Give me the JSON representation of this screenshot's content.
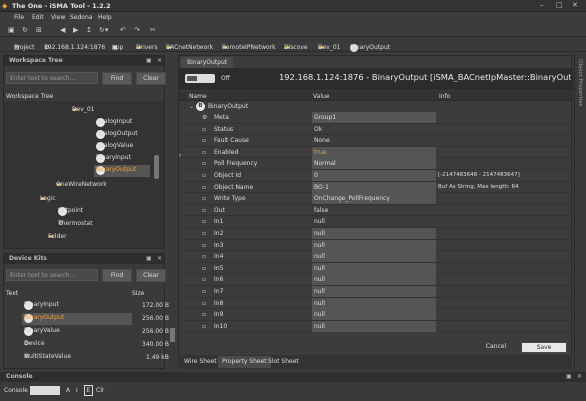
{
  "window": {
    "title": "The One - iSMA Tool - 1.2.2",
    "minimize": "–",
    "maximize": "□",
    "close": "✕"
  },
  "menu": [
    "File",
    "Edit",
    "View",
    "Sedona",
    "Help"
  ],
  "breadcrumb": [
    "Project",
    "192.168.1.124:1876",
    "app",
    "Drivers",
    "BACnetNetwork",
    "RemoteIPNetwork",
    "Discove",
    "Dev_01",
    "BinaryOutput"
  ],
  "workspace": {
    "title": "Workspace Tree",
    "search_placeholder": "Enter text to search...",
    "find": "Find",
    "clear": "Clear",
    "tree_label": "Workspace Tree",
    "items": [
      {
        "label": "Dev_01",
        "icon": "folder"
      },
      {
        "label": "AnalogInput",
        "icon": "N"
      },
      {
        "label": "AnalogOutput",
        "icon": "N"
      },
      {
        "label": "AnalogValue",
        "icon": "N"
      },
      {
        "label": "BinaryInput",
        "icon": "B"
      },
      {
        "label": "BinaryOutput",
        "icon": "B"
      },
      {
        "label": "OneWireNetwork",
        "icon": "folder"
      },
      {
        "label": "Logic",
        "icon": "folder"
      },
      {
        "label": "Setpoint",
        "icon": "N"
      },
      {
        "label": "Thermostat",
        "icon": "gear"
      },
      {
        "label": "Folder",
        "icon": "folder"
      }
    ]
  },
  "devicekits": {
    "title": "Device Kits",
    "search_placeholder": "Enter text to search...",
    "find": "Find",
    "clear": "Clear",
    "col_text": "Text",
    "col_size": "Size",
    "items": [
      {
        "label": "BinaryInput",
        "size": "172.00 B",
        "icon": "B"
      },
      {
        "label": "BinaryOutput",
        "size": "256.00 B",
        "icon": "B"
      },
      {
        "label": "BinaryValue",
        "size": "256.00 B",
        "icon": "B"
      },
      {
        "label": "Device",
        "size": "340.00 B",
        "icon": "gear"
      },
      {
        "label": "MultiStateValue",
        "size": "1.49 kB",
        "icon": "gear"
      }
    ]
  },
  "editor": {
    "tab": "BinaryOutput",
    "toggle_label": "Off",
    "heading": "192.168.1.124:1876 - BinaryOutput [iSMA_BACnetIpMaster::BinaryOutput]",
    "col_name": "Name",
    "col_value": "Value",
    "col_info": "Info",
    "root": "BinaryOutput",
    "rows": [
      {
        "name": "Meta",
        "value": "Group1",
        "info": ""
      },
      {
        "name": "Status",
        "value": "Ok",
        "info": ""
      },
      {
        "name": "Fault Cause",
        "value": "None",
        "info": ""
      },
      {
        "name": "Enabled",
        "value": "true",
        "info": ""
      },
      {
        "name": "Poll Frequency",
        "value": "Normal",
        "info": ""
      },
      {
        "name": "Object Id",
        "value": "0",
        "info": "[-2147483648 - 2147483647]"
      },
      {
        "name": "Object Name",
        "value": "BO-1",
        "info": "Buf As String, Max length: 64"
      },
      {
        "name": "Write Type",
        "value": "OnChange_PollFrequency",
        "info": ""
      },
      {
        "name": "Out",
        "value": "false",
        "info": ""
      },
      {
        "name": "In1",
        "value": "null",
        "info": ""
      },
      {
        "name": "In2",
        "value": "null",
        "info": ""
      },
      {
        "name": "In3",
        "value": "null",
        "info": ""
      },
      {
        "name": "In4",
        "value": "null",
        "info": ""
      },
      {
        "name": "In5",
        "value": "null",
        "info": ""
      },
      {
        "name": "In6",
        "value": "null",
        "info": ""
      },
      {
        "name": "In7",
        "value": "null",
        "info": ""
      },
      {
        "name": "In8",
        "value": "null",
        "info": ""
      },
      {
        "name": "In9",
        "value": "null",
        "info": ""
      },
      {
        "name": "In10",
        "value": "null",
        "info": ""
      }
    ],
    "cancel": "Cancel",
    "save": "Save",
    "tabs": [
      "Wire Sheet",
      "Property Sheet",
      "Slot Sheet"
    ]
  },
  "right_panel": "Object Properties",
  "console": {
    "title": "Console",
    "label": "Console",
    "buttons": [
      "A",
      "I",
      "E",
      "Clr"
    ]
  },
  "colors": {
    "accent": "#e8a040",
    "selected_bg": "#3c3c3c"
  }
}
